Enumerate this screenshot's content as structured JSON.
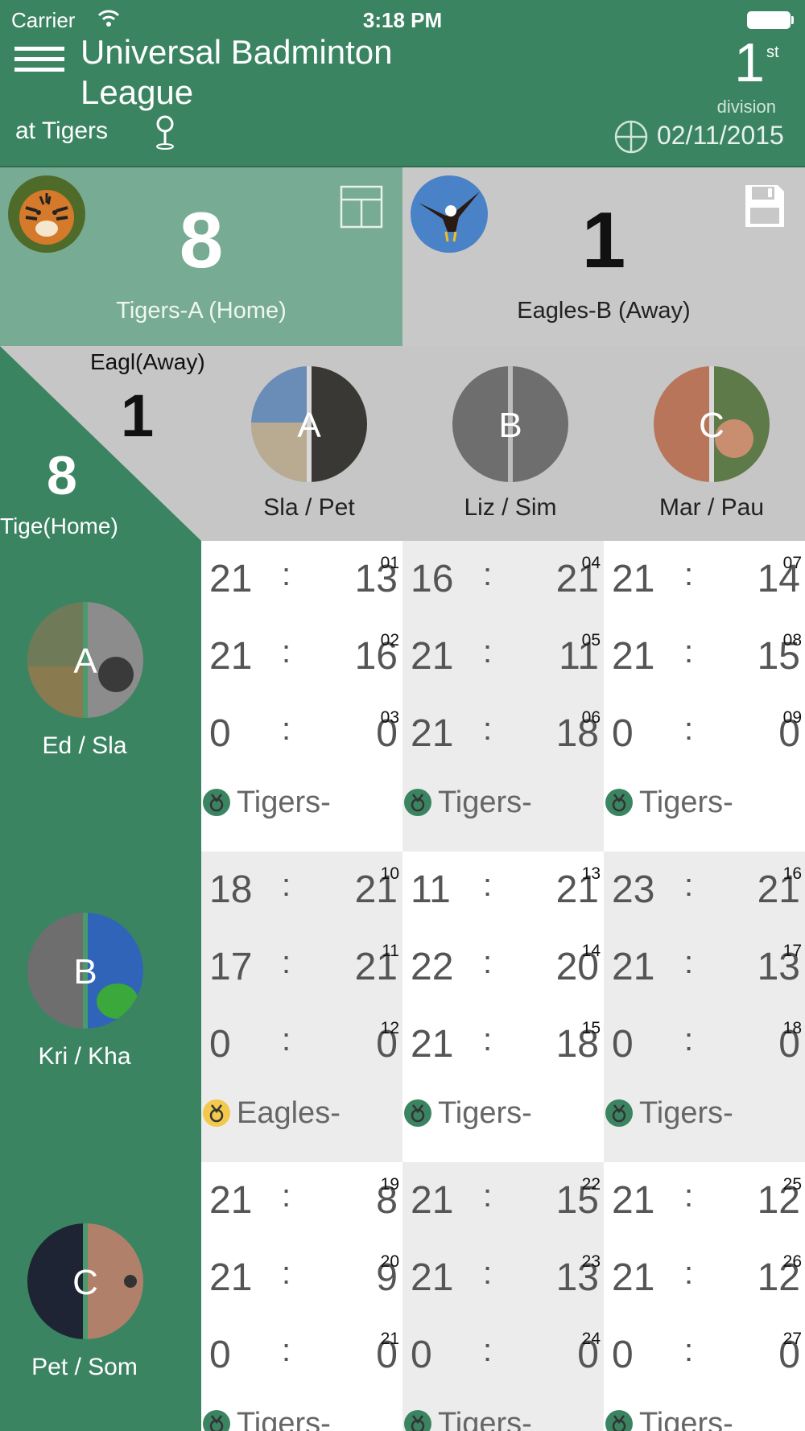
{
  "status_bar": {
    "carrier": "Carrier",
    "time": "3:18 PM"
  },
  "header": {
    "title": "Universal Badminton League",
    "venue": "at Tigers",
    "division_number": "1",
    "division_suffix": "st",
    "division_label": "division",
    "date": "02/11/2015"
  },
  "home": {
    "score": "8",
    "name": "Tigers-A (Home)",
    "corner_label": "Tige(Home)"
  },
  "away": {
    "score": "1",
    "name": "Eagles-B (Away)",
    "corner_label": "Eagl(Away)"
  },
  "away_pairs": [
    {
      "letter": "A",
      "name": "Sla / Pet"
    },
    {
      "letter": "B",
      "name": "Liz / Sim"
    },
    {
      "letter": "C",
      "name": "Mar / Pau"
    }
  ],
  "home_pairs": [
    {
      "letter": "A",
      "name": "Ed / Sla"
    },
    {
      "letter": "B",
      "name": "Kri / Kha"
    },
    {
      "letter": "C",
      "name": "Pet / Som"
    }
  ],
  "colors": {
    "header_green": "#3b8462",
    "medal_green": "#3b8462",
    "medal_gold": "#f2c94c"
  },
  "matches": [
    [
      {
        "games": [
          [
            "21",
            "13",
            "01"
          ],
          [
            "21",
            "16",
            "02"
          ],
          [
            "0",
            "0",
            "03"
          ]
        ],
        "winner": "Tigers-",
        "medal": "green"
      },
      {
        "games": [
          [
            "16",
            "21",
            "04"
          ],
          [
            "21",
            "11",
            "05"
          ],
          [
            "21",
            "18",
            "06"
          ]
        ],
        "winner": "Tigers-",
        "medal": "green"
      },
      {
        "games": [
          [
            "21",
            "14",
            "07"
          ],
          [
            "21",
            "15",
            "08"
          ],
          [
            "0",
            "0",
            "09"
          ]
        ],
        "winner": "Tigers-",
        "medal": "green"
      }
    ],
    [
      {
        "games": [
          [
            "18",
            "21",
            "10"
          ],
          [
            "17",
            "21",
            "11"
          ],
          [
            "0",
            "0",
            "12"
          ]
        ],
        "winner": "Eagles-",
        "medal": "gold"
      },
      {
        "games": [
          [
            "11",
            "21",
            "13"
          ],
          [
            "22",
            "20",
            "14"
          ],
          [
            "21",
            "18",
            "15"
          ]
        ],
        "winner": "Tigers-",
        "medal": "green"
      },
      {
        "games": [
          [
            "23",
            "21",
            "16"
          ],
          [
            "21",
            "13",
            "17"
          ],
          [
            "0",
            "0",
            "18"
          ]
        ],
        "winner": "Tigers-",
        "medal": "green"
      }
    ],
    [
      {
        "games": [
          [
            "21",
            "8",
            "19"
          ],
          [
            "21",
            "9",
            "20"
          ],
          [
            "0",
            "0",
            "21"
          ]
        ],
        "winner": "Tigers-",
        "medal": "green"
      },
      {
        "games": [
          [
            "21",
            "15",
            "22"
          ],
          [
            "21",
            "13",
            "23"
          ],
          [
            "0",
            "0",
            "24"
          ]
        ],
        "winner": "Tigers-",
        "medal": "green"
      },
      {
        "games": [
          [
            "21",
            "12",
            "25"
          ],
          [
            "21",
            "12",
            "26"
          ],
          [
            "0",
            "0",
            "27"
          ]
        ],
        "winner": "Tigers-",
        "medal": "green"
      }
    ]
  ]
}
